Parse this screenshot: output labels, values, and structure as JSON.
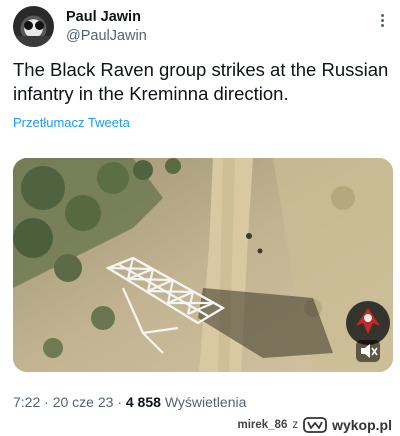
{
  "author": {
    "display_name": "Paul Jawin",
    "handle": "@PaulJawin",
    "avatar_icon": "owl-avatar-icon"
  },
  "tweet": {
    "text": "The Black Raven group strikes at the Russian infantry in the Kreminna direction.",
    "translate_label": "Przetłumacz Tweeta",
    "more_icon": "more-vertical-icon"
  },
  "media": {
    "type": "aerial-drone-video",
    "unit_badge_icon": "black-raven-unit-badge-icon",
    "mute_icon": "speaker-mute-icon"
  },
  "meta": {
    "time": "7:22",
    "separator": "·",
    "date": "20 cze 23",
    "views_count": "4 858",
    "views_label": "Wyświetlenia"
  },
  "watermark": {
    "user": "mirek_86",
    "preposition": "z",
    "brand": "wykop.pl",
    "logo_icon": "wykop-logo-icon"
  },
  "colors": {
    "text": "#0f1419",
    "secondary": "#536471",
    "link": "#1d9bf0",
    "background": "#ffffff"
  }
}
